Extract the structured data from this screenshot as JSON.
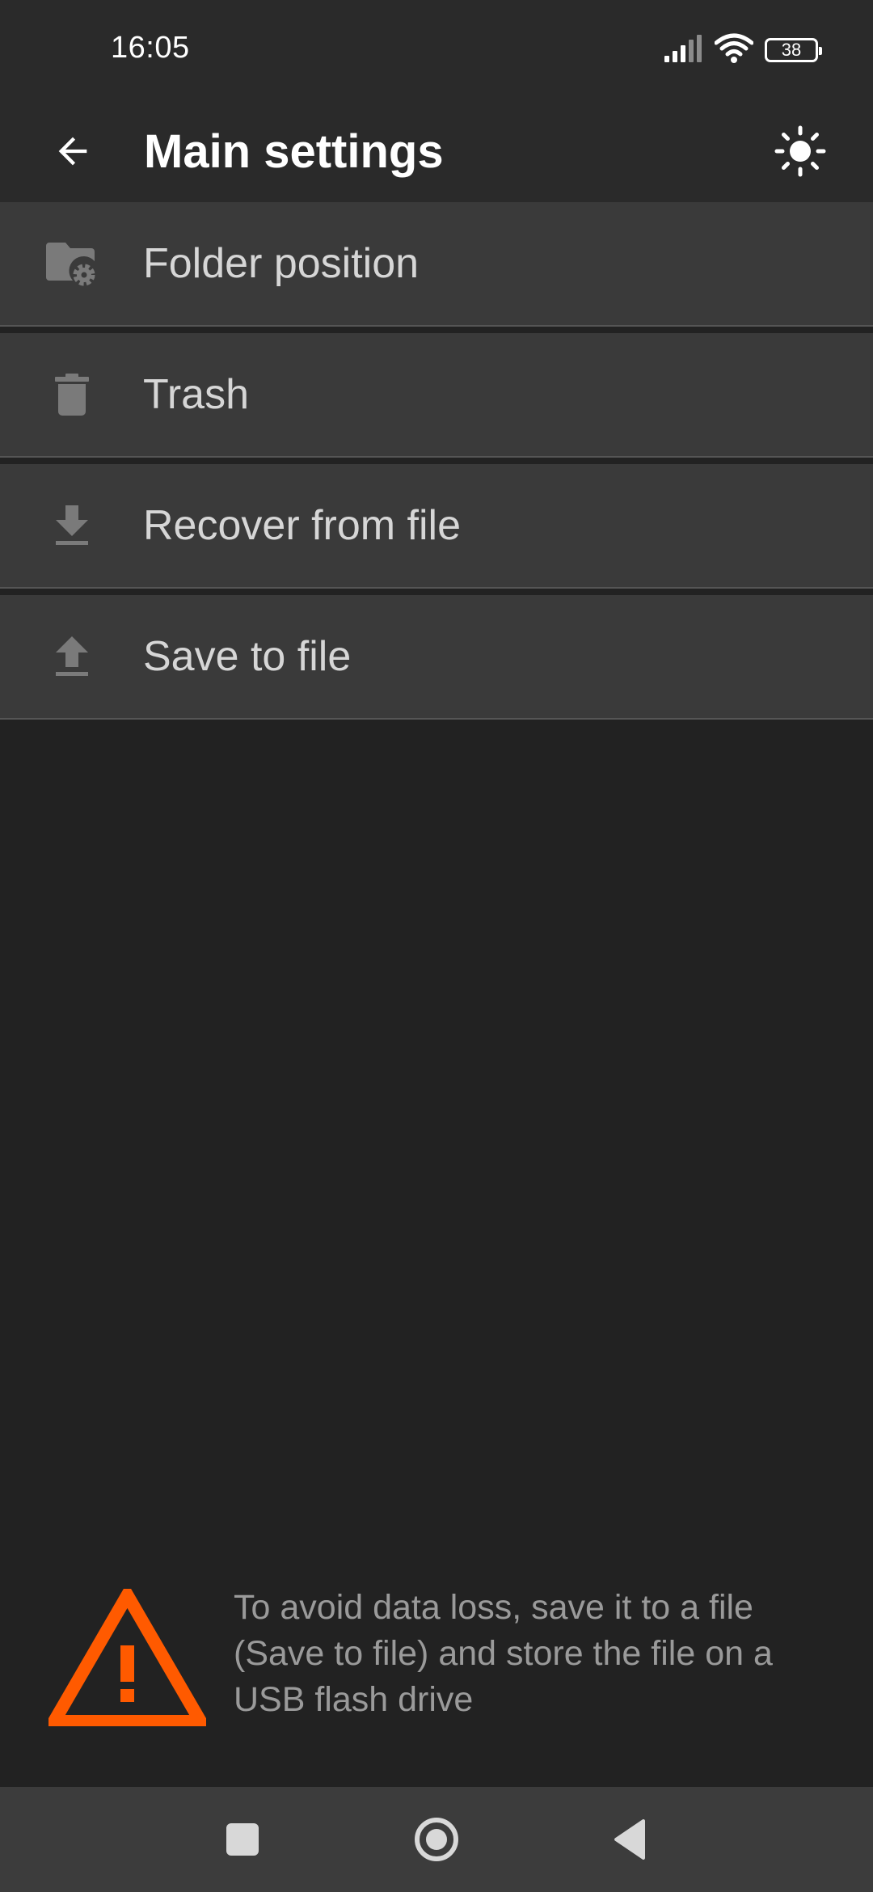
{
  "status_bar": {
    "time": "16:05",
    "battery_level": "38",
    "icons": [
      "signal-icon",
      "wifi-icon",
      "battery-icon"
    ]
  },
  "app_bar": {
    "title": "Main settings",
    "back_icon": "arrow-back-icon",
    "theme_icon": "brightness-icon"
  },
  "menu": {
    "items": [
      {
        "label": "Folder position",
        "icon": "folder-settings-icon"
      },
      {
        "label": "Trash",
        "icon": "trash-icon"
      },
      {
        "label": "Recover from file",
        "icon": "download-icon"
      },
      {
        "label": "Save to file",
        "icon": "upload-icon"
      }
    ]
  },
  "warning": {
    "text": "To avoid data loss, save it to a file (Save to file) and store the file on a USB flash drive",
    "icon": "warning-icon",
    "color": "#ff5a00"
  },
  "nav_bar": {
    "icons": [
      "recents-icon",
      "home-icon",
      "back-icon"
    ]
  },
  "colors": {
    "background": "#222222",
    "app_bar": "#2a2a2a",
    "menu_item": "#3a3a3a",
    "menu_text": "#d6d6d6",
    "menu_icon": "#7a7a7a",
    "warning": "#ff5a00"
  }
}
